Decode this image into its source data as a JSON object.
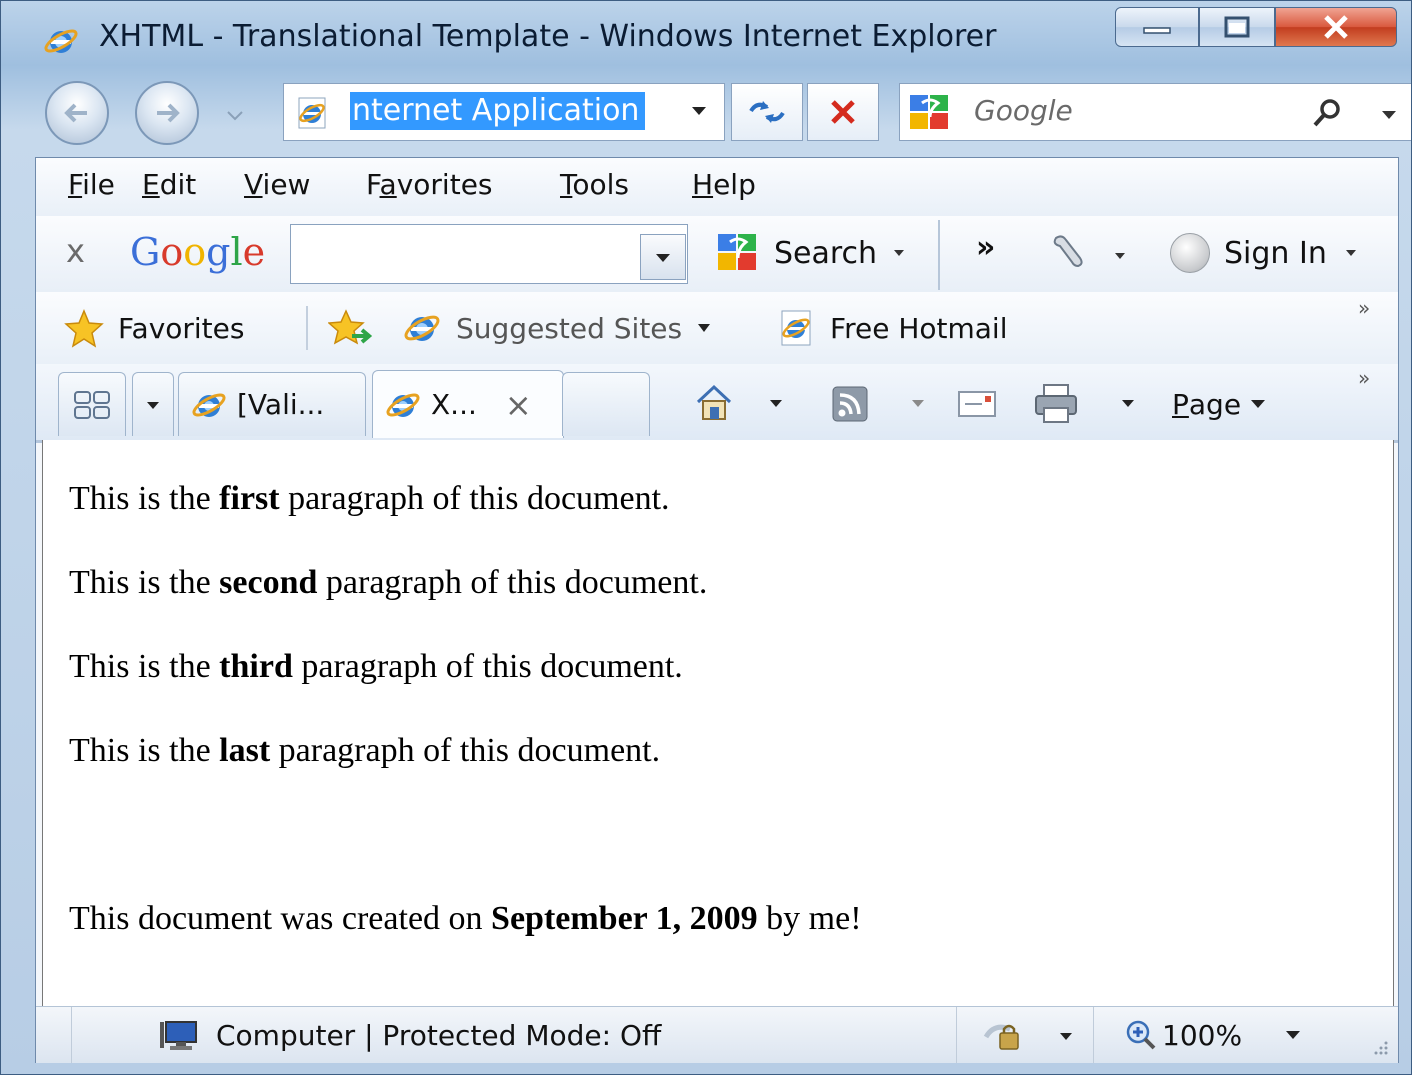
{
  "window": {
    "title": "XHTML - Translational Template - Windows Internet Explorer"
  },
  "address": {
    "value": "nternet Application"
  },
  "google_box": {
    "placeholder": "Google"
  },
  "menubar": {
    "items": [
      {
        "label": "File",
        "underline": "F"
      },
      {
        "label": "Edit",
        "underline": "E"
      },
      {
        "label": "View",
        "underline": "V"
      },
      {
        "label": "Favorites",
        "underline": "a"
      },
      {
        "label": "Tools",
        "underline": "T"
      },
      {
        "label": "Help",
        "underline": "H"
      }
    ]
  },
  "google_toolbar": {
    "close": "x",
    "logo": "Google",
    "search_label": "Search",
    "more": "»",
    "signin_label": "Sign In"
  },
  "favorites_bar": {
    "favorites_label": "Favorites",
    "suggested_label": "Suggested Sites",
    "hotmail_label": "Free Hotmail",
    "overflow": "»"
  },
  "tabs": {
    "items": [
      {
        "label": "[Vali...",
        "active": false
      },
      {
        "label": "X...",
        "active": true,
        "close": "×"
      }
    ],
    "page_menu": "Page",
    "overflow": "»"
  },
  "document": {
    "paragraphs": [
      {
        "before": "This is the ",
        "bold": "first",
        "after": " paragraph of this document."
      },
      {
        "before": "This is the ",
        "bold": "second",
        "after": " paragraph of this document."
      },
      {
        "before": "This is the ",
        "bold": "third",
        "after": " paragraph of this document."
      },
      {
        "before": "This is the ",
        "bold": "last",
        "after": " paragraph of this document."
      },
      {
        "before": "This document was created on ",
        "bold": "September 1, 2009",
        "after": " by me!"
      }
    ]
  },
  "statusbar": {
    "zone": "Computer | Protected Mode: Off",
    "zoom": "100%"
  },
  "icons": {
    "ie": "ie-icon",
    "back": "back-arrow-icon",
    "forward": "forward-arrow-icon",
    "refresh": "refresh-icon",
    "stop": "stop-icon",
    "google": "google-icon",
    "search": "magnifier-icon",
    "wrench": "wrench-icon",
    "star": "star-icon",
    "home": "home-icon",
    "feed": "feed-icon",
    "mail": "mail-icon",
    "print": "print-icon",
    "zoom": "zoom-icon",
    "quicktabs": "quick-tabs-icon"
  },
  "colors": {
    "selection": "#3399ff",
    "frame": "#6f8aab",
    "close_button": "#c23d1f"
  }
}
